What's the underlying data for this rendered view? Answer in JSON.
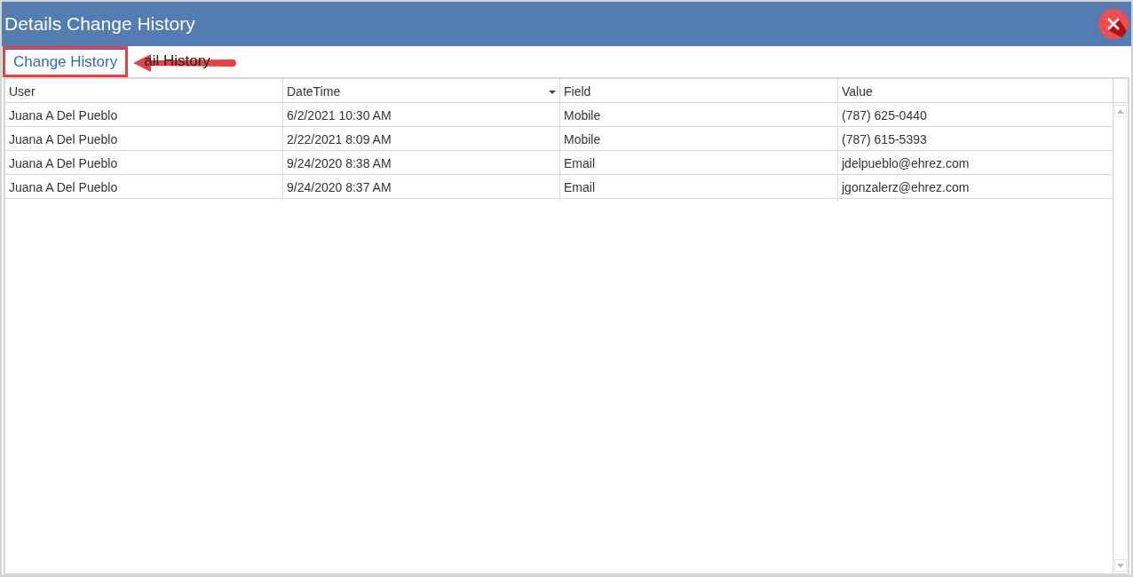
{
  "window": {
    "title": "Details Change History"
  },
  "tabs": [
    {
      "label": "Change History",
      "selected": true,
      "highlighted": true
    },
    {
      "label": "ail History",
      "selected": false,
      "highlighted": false
    }
  ],
  "table": {
    "columns": [
      {
        "label": "User",
        "sorted": false
      },
      {
        "label": "DateTime",
        "sorted": true
      },
      {
        "label": "Field",
        "sorted": false
      },
      {
        "label": "Value",
        "sorted": false
      }
    ],
    "rows": [
      [
        "Juana A Del Pueblo",
        "6/2/2021 10:30 AM",
        "Mobile",
        "(787) 625-0440"
      ],
      [
        "Juana A Del Pueblo",
        "2/22/2021 8:09 AM",
        "Mobile",
        "(787) 615-5393"
      ],
      [
        "Juana A Del Pueblo",
        "9/24/2020 8:38 AM",
        "Email",
        "jdelpueblo@ehrez.com"
      ],
      [
        "Juana A Del Pueblo",
        "9/24/2020 8:37 AM",
        "Email",
        "jgonzalerz@ehrez.com"
      ]
    ]
  }
}
